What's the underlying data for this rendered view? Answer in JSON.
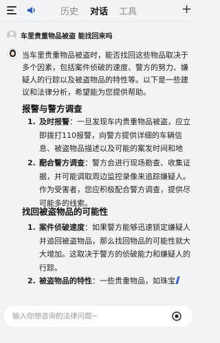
{
  "header": {
    "tabs": [
      {
        "label": "历史",
        "active": false
      },
      {
        "label": "对话",
        "active": true
      },
      {
        "label": "工具",
        "active": false
      }
    ],
    "icons": [
      "menu-icon",
      "speaker-icon",
      "plus-icon"
    ]
  },
  "question": {
    "text": "车里贵重物品被盗 能找回来吗"
  },
  "answer": {
    "intro": "当车里贵重物品被盗时，能否找回这些物品取决于多个因素，包括案件侦破的速度、警方的努力、嫌疑人的行踪以及被盗物品的特性等。以下是一些建议和法律分析，希望能为您提供帮助。",
    "sections": [
      {
        "heading": "报警与警方调查",
        "items": [
          {
            "num": "1.",
            "keyword": "及时报警",
            "text": "：一旦发现车内贵重物品被盗，应立即拨打110报警，向警方提供详细的车辆信息、被盗物品描述以及可能的案发时间和地点。"
          },
          {
            "num": "2.",
            "keyword": "配合警方调查",
            "text": "：警方会进行现场勘查、收集证据，并可能调取周边监控录像来追踪嫌疑人。作为受害者，您应积极配合警方调查，提供尽可能多的线索。"
          }
        ]
      },
      {
        "heading": "找回被盗物品的可能性",
        "items": [
          {
            "num": "1.",
            "keyword": "案件侦破速度",
            "text": "：如果警方能够迅速锁定嫌疑人并追回被盗物品，那么找回物品的可能性就大大增加。这取决于警方的侦破能力和嫌疑人的行踪。"
          },
          {
            "num": "2.",
            "keyword": "被盗物品的特性",
            "text": "：一些贵重物品，如珠宝"
          }
        ]
      }
    ]
  },
  "input": {
    "placeholder": "输入你想咨询的法律问题~"
  },
  "colors": {
    "background": "#f2f3f5",
    "accent": "#2a5bd7",
    "inactive_tab": "#8c8c8c"
  }
}
